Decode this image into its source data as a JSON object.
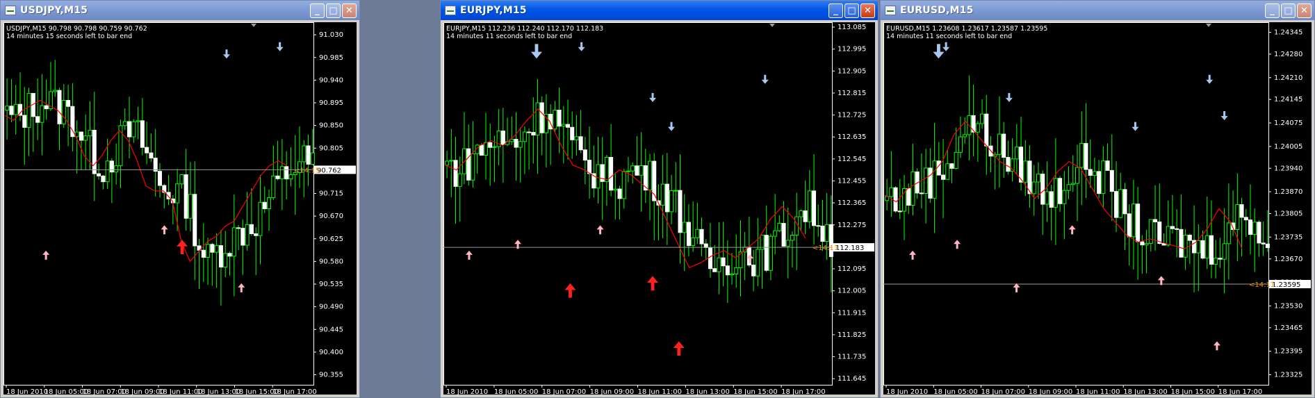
{
  "windows": [
    {
      "title": "USDJPY,M15",
      "active": false,
      "info_line1": "USDJPY,M15  90.798 90.798 90.759 90.762",
      "info_line2": "14 minutes 15 seconds left to bar end",
      "countdown": "<14:15",
      "price_label": "90.762",
      "chart_data": {
        "type": "candlestick",
        "symbol": "USDJPY",
        "timeframe": "M15",
        "ohlc_header": {
          "open": 90.798,
          "high": 90.798,
          "low": 90.759,
          "close": 90.762
        },
        "last_price": 90.762,
        "y_ticks": [
          "91.030",
          "90.985",
          "90.940",
          "90.895",
          "90.850",
          "90.805",
          "90.760",
          "90.715",
          "90.670",
          "90.625",
          "90.580",
          "90.535",
          "90.490",
          "90.445",
          "90.400",
          "90.355"
        ],
        "x_ticks": [
          "18 Jun 2010",
          "18 Jun 05:00",
          "18 Jun 07:00",
          "18 Jun 09:00",
          "18 Jun 11:00",
          "18 Jun 13:00",
          "18 Jun 15:00",
          "18 Jun 17:00"
        ],
        "ylim": [
          90.335,
          91.055
        ],
        "close_path": [
          90.87,
          90.86,
          90.88,
          90.89,
          90.9,
          90.89,
          90.88,
          90.86,
          90.83,
          90.79,
          90.77,
          90.79,
          90.82,
          90.84,
          90.82,
          90.78,
          90.73,
          90.72,
          90.72,
          90.7,
          90.62,
          90.58,
          90.6,
          90.62,
          90.63,
          90.65,
          90.66,
          90.69,
          90.72,
          90.75,
          90.77,
          90.78,
          90.77
        ],
        "up_arrows": [
          0.12,
          0.58,
          0.78,
          0.52
        ],
        "down_arrows": [
          0.73,
          0.91
        ]
      }
    },
    {
      "title": "EURJPY,M15",
      "active": true,
      "info_line1": "EURJPY,M15  112.236 112.240 112.170 112.183",
      "info_line2": "14 minutes 11 seconds left to bar end",
      "countdown": "<14:11",
      "price_label": "112.183",
      "chart_data": {
        "type": "candlestick",
        "symbol": "EURJPY",
        "timeframe": "M15",
        "ohlc_header": {
          "open": 112.236,
          "high": 112.24,
          "low": 112.17,
          "close": 112.183
        },
        "last_price": 112.183,
        "y_ticks": [
          "113.085",
          "112.995",
          "112.905",
          "112.815",
          "112.725",
          "112.635",
          "112.545",
          "112.455",
          "112.365",
          "112.275",
          "112.185",
          "112.095",
          "112.005",
          "111.915",
          "111.825",
          "111.735",
          "111.645"
        ],
        "x_ticks": [
          "18 Jun 2010",
          "18 Jun 05:00",
          "18 Jun 07:00",
          "18 Jun 09:00",
          "18 Jun 11:00",
          "18 Jun 13:00",
          "18 Jun 15:00",
          "18 Jun 17:00"
        ],
        "ylim": [
          111.62,
          113.105
        ],
        "close_path": [
          112.52,
          112.5,
          112.55,
          112.6,
          112.62,
          112.6,
          112.64,
          112.7,
          112.75,
          112.7,
          112.6,
          112.52,
          112.5,
          112.47,
          112.46,
          112.5,
          112.48,
          112.44,
          112.4,
          112.3,
          112.2,
          112.1,
          112.12,
          112.15,
          112.17,
          112.14,
          112.18,
          112.22,
          112.3,
          112.35,
          112.3,
          112.22
        ],
        "up_arrows": [
          0.05,
          0.18,
          0.32,
          0.4,
          0.54,
          0.61,
          0.8
        ],
        "down_arrows": [
          0.23,
          0.35,
          0.54,
          0.59,
          0.84
        ]
      }
    },
    {
      "title": "EURUSD,M15",
      "active": false,
      "info_line1": "EURUSD,M15  1.23608 1.23617 1.23587 1.23595",
      "info_line2": "14 minutes 11 seconds left to bar end",
      "countdown": "<14:11",
      "price_label": "1.23595",
      "chart_data": {
        "type": "candlestick",
        "symbol": "EURUSD",
        "timeframe": "M15",
        "ohlc_header": {
          "open": 1.23608,
          "high": 1.23617,
          "low": 1.23587,
          "close": 1.23595
        },
        "last_price": 1.23595,
        "y_ticks": [
          "1.24345",
          "1.24280",
          "1.24210",
          "1.24145",
          "1.24075",
          "1.24005",
          "1.23940",
          "1.23870",
          "1.23805",
          "1.23735",
          "1.23670",
          "1.23600",
          "1.23530",
          "1.23465",
          "1.23395",
          "1.23325"
        ],
        "x_ticks": [
          "18 Jun 2010",
          "18 Jun 05:00",
          "18 Jun 07:00",
          "18 Jun 09:00",
          "18 Jun 11:00",
          "18 Jun 13:00",
          "18 Jun 15:00",
          "18 Jun 17:00"
        ],
        "ylim": [
          1.23295,
          1.24375
        ],
        "close_path": [
          1.2386,
          1.2384,
          1.2388,
          1.239,
          1.2392,
          1.2396,
          1.2404,
          1.2408,
          1.2404,
          1.24,
          1.2396,
          1.2394,
          1.239,
          1.2385,
          1.2388,
          1.2393,
          1.2396,
          1.2394,
          1.2388,
          1.2382,
          1.2378,
          1.2374,
          1.2372,
          1.2373,
          1.2372,
          1.2371,
          1.237,
          1.2372,
          1.2376,
          1.2382,
          1.2378,
          1.237
        ],
        "up_arrows": [
          0.06,
          0.18,
          0.34,
          0.49,
          0.73,
          0.88
        ],
        "down_arrows": [
          0.13,
          0.15,
          0.32,
          0.66,
          0.86,
          0.9
        ]
      }
    }
  ]
}
